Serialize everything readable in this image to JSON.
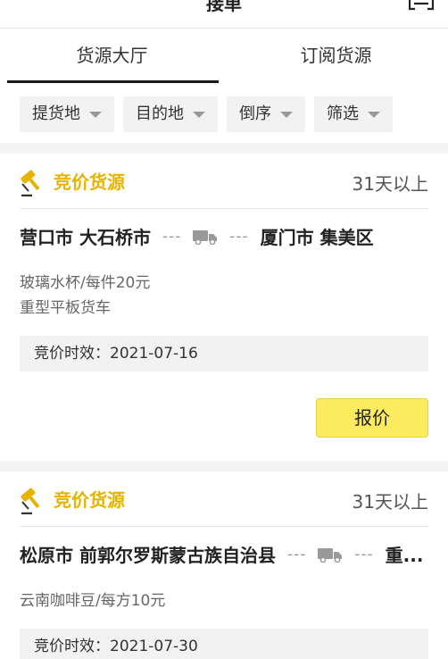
{
  "header": {
    "title": "接单"
  },
  "tabs": [
    {
      "label": "货源大厅",
      "active": true
    },
    {
      "label": "订阅货源",
      "active": false
    }
  ],
  "filters": [
    {
      "label": "提货地"
    },
    {
      "label": "目的地"
    },
    {
      "label": "倒序"
    },
    {
      "label": "筛选"
    }
  ],
  "colors": {
    "accent": "#e6b400",
    "button_bg": "#fbeb5e"
  },
  "cards": [
    {
      "type_label": "竞价货源",
      "time_label": "31天以上",
      "origin": "营口市 大石桥市",
      "dash": "---",
      "destination": "厦门市 集美区",
      "goods": "玻璃水杯/每件20元",
      "vehicle": "重型平板货车",
      "bid_time": "竞价时效：2021-07-16",
      "quote_label": "报价"
    },
    {
      "type_label": "竞价货源",
      "time_label": "31天以上",
      "origin": "松原市 前郭尔罗斯蒙古族自治县",
      "dash": "---",
      "destination": "重...",
      "goods": "云南咖啡豆/每方10元",
      "bid_time": "竞价时效：2021-07-30"
    }
  ]
}
